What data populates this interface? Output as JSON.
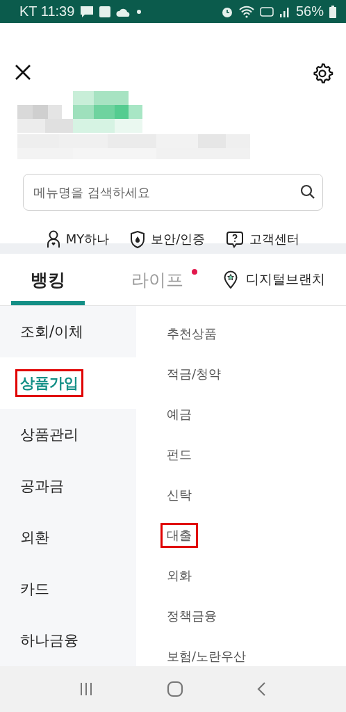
{
  "status_bar": {
    "carrier_time": "KT 11:39",
    "battery": "56%"
  },
  "search": {
    "placeholder": "메뉴명을 검색하세요"
  },
  "quick_links": [
    {
      "label": "MY하나"
    },
    {
      "label": "보안/인증"
    },
    {
      "label": "고객센터"
    }
  ],
  "tabs": [
    {
      "label": "뱅킹",
      "selected": true,
      "new": false
    },
    {
      "label": "라이프",
      "selected": false,
      "new": true
    }
  ],
  "digital_branch": {
    "label": "디지털브랜치"
  },
  "categories": [
    {
      "label": "조회/이체",
      "selected": false,
      "annotated": false
    },
    {
      "label": "상품가입",
      "selected": true,
      "annotated": true
    },
    {
      "label": "상품관리",
      "selected": false,
      "annotated": false
    },
    {
      "label": "공과금",
      "selected": false,
      "annotated": false
    },
    {
      "label": "외환",
      "selected": false,
      "annotated": false
    },
    {
      "label": "카드",
      "selected": false,
      "annotated": false
    },
    {
      "label": "하나금융",
      "selected": false,
      "annotated": false
    }
  ],
  "submenu": [
    {
      "label": "추천상품",
      "annotated": false
    },
    {
      "label": "적금/청약",
      "annotated": false
    },
    {
      "label": "예금",
      "annotated": false
    },
    {
      "label": "펀드",
      "annotated": false
    },
    {
      "label": "신탁",
      "annotated": false
    },
    {
      "label": "대출",
      "annotated": true
    },
    {
      "label": "외화",
      "annotated": false
    },
    {
      "label": "정책금융",
      "annotated": false
    },
    {
      "label": "보험/노란우산",
      "annotated": false
    }
  ]
}
